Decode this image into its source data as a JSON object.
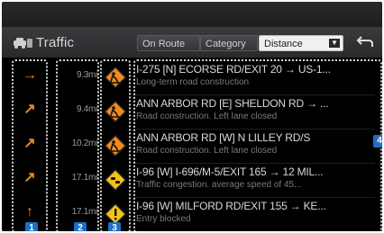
{
  "header": {
    "title": "Traffic",
    "tabs": [
      {
        "label": "On Route"
      },
      {
        "label": "Category"
      },
      {
        "label": "Distance"
      }
    ],
    "dropdown_arrow": "▼",
    "back_icon": "back-arrow-icon"
  },
  "callouts": [
    "1",
    "2",
    "3",
    "4"
  ],
  "rows": [
    {
      "arrow": "→",
      "distance": "9.3mi",
      "badge": "construction-icon",
      "title": "I-275 [N] ECORSE RD/EXIT 20 → US-1...",
      "desc": "Long-term road construction"
    },
    {
      "arrow": "↗",
      "distance": "9.4mi",
      "badge": "construction-icon",
      "title": "ANN ARBOR RD [E] SHELDON RD → ...",
      "desc": "Road construction. Left lane closed"
    },
    {
      "arrow": "↗",
      "distance": "10.2mi",
      "badge": "construction-icon",
      "title": "ANN ARBOR RD [W] N LILLEY RD/S",
      "desc": "Road construction. Left lane closed"
    },
    {
      "arrow": "↗",
      "distance": "17.1mi",
      "badge": "congestion-icon",
      "title": "I-96 [W] I-696/M-5/EXIT 165 → 12 MIL...",
      "desc": "Traffic congestion. average speed of 45..."
    },
    {
      "arrow": "↑",
      "distance": "17.1mi",
      "badge": "warning-icon",
      "title": "I-96 [W] MILFORD RD/EXIT 155 → KE...",
      "desc": "Entry blocked"
    }
  ],
  "colors": {
    "accent": "#f08a1a",
    "callout": "#1e6fc4"
  }
}
